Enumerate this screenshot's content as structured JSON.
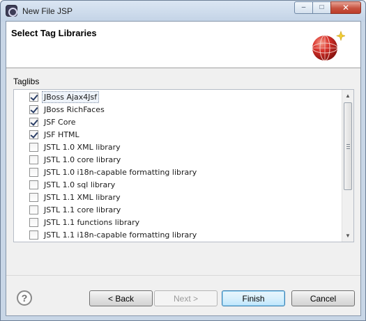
{
  "window": {
    "title": "New File JSP",
    "controls": {
      "minimize": "–",
      "maximize": "□",
      "close": "✕"
    }
  },
  "banner": {
    "title": "Select Tag Libraries",
    "icon": "wizard-globe-icon"
  },
  "taglibs": {
    "label": "Taglibs",
    "items": [
      {
        "label": "JBoss Ajax4Jsf",
        "checked": true,
        "focused": true
      },
      {
        "label": "JBoss RichFaces",
        "checked": true
      },
      {
        "label": "JSF Core",
        "checked": true
      },
      {
        "label": "JSF HTML",
        "checked": true
      },
      {
        "label": "JSTL 1.0 XML library",
        "checked": false
      },
      {
        "label": "JSTL 1.0 core library",
        "checked": false
      },
      {
        "label": "JSTL 1.0 i18n-capable formatting library",
        "checked": false
      },
      {
        "label": "JSTL 1.0 sql library",
        "checked": false
      },
      {
        "label": "JSTL 1.1 XML library",
        "checked": false
      },
      {
        "label": "JSTL 1.1 core library",
        "checked": false
      },
      {
        "label": "JSTL 1.1 functions library",
        "checked": false
      },
      {
        "label": "JSTL 1.1 i18n-capable formatting library",
        "checked": false
      }
    ]
  },
  "buttons": {
    "help": "?",
    "back": "< Back",
    "next": "Next >",
    "finish": "Finish",
    "cancel": "Cancel"
  },
  "colors": {
    "accent": "#3c7fb1",
    "close_button": "#c75340"
  }
}
